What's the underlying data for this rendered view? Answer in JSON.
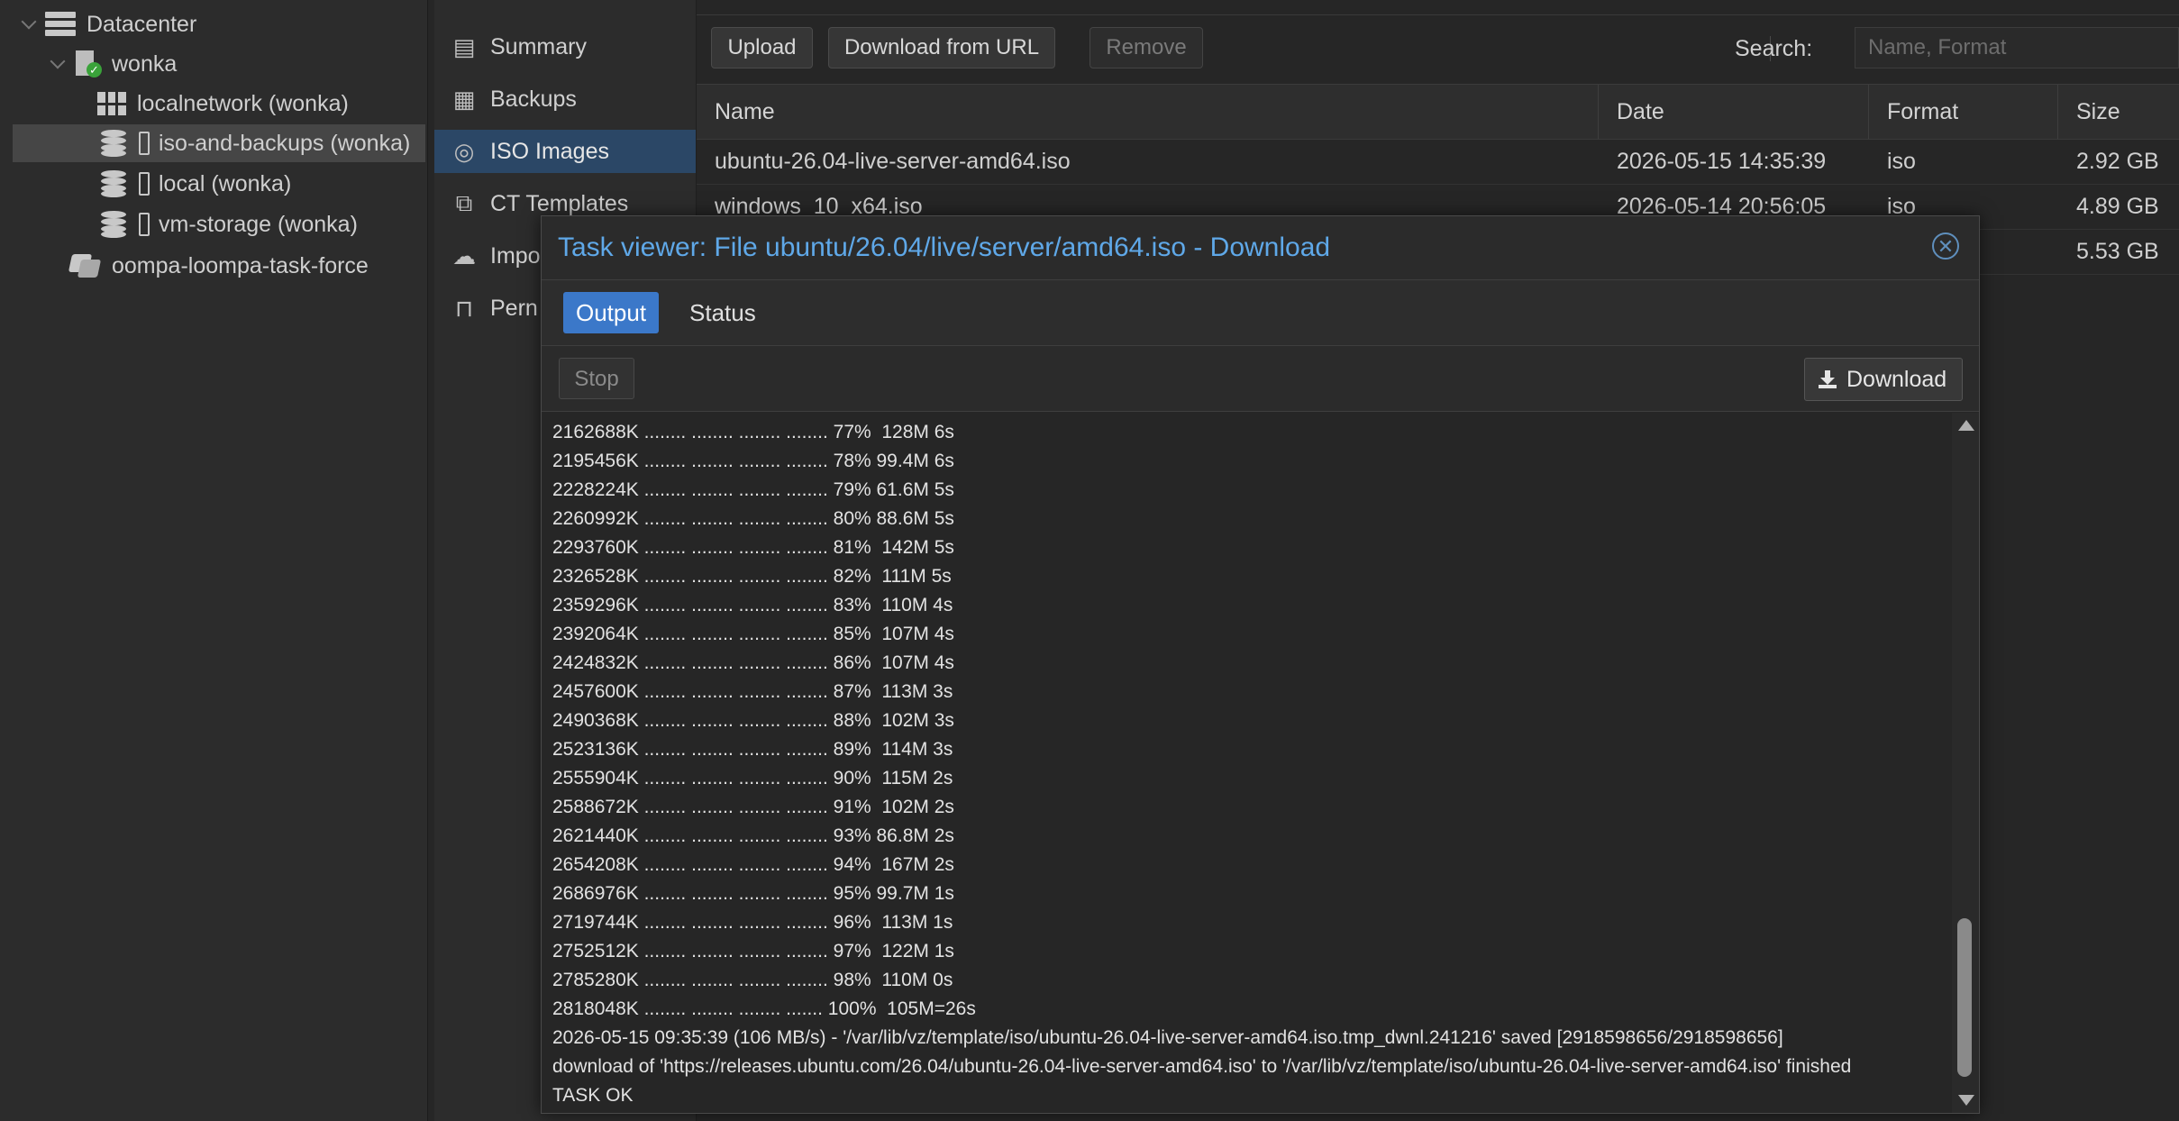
{
  "tree": {
    "datacenter": "Datacenter",
    "node": "wonka",
    "items": [
      {
        "label": "localnetwork (wonka)",
        "icon": "grid-icon"
      },
      {
        "label": "iso-and-backups (wonka)",
        "icon": "storage-icon"
      },
      {
        "label": "local (wonka)",
        "icon": "storage-icon"
      },
      {
        "label": "vm-storage (wonka)",
        "icon": "storage-icon"
      }
    ],
    "pool": "oompa-loompa-task-force",
    "selected": "iso-and-backups (wonka)"
  },
  "nav": {
    "items": [
      "Summary",
      "Backups",
      "ISO Images",
      "CT Templates",
      "Impo",
      "Pern"
    ],
    "selected": "ISO Images"
  },
  "toolbar": {
    "upload": "Upload",
    "download_url": "Download from URL",
    "remove": "Remove",
    "search_label": "Search:",
    "search_placeholder": "Name, Format"
  },
  "grid": {
    "columns": [
      "Name",
      "Date",
      "Format",
      "Size"
    ],
    "rows": [
      {
        "name": "ubuntu-26.04-live-server-amd64.iso",
        "date": "2026-05-15 14:35:39",
        "format": "iso",
        "size": "2.92 GB"
      },
      {
        "name": "windows_10_x64.iso",
        "date": "2026-05-14 20:56:05",
        "format": "iso",
        "size": "4.89 GB"
      },
      {
        "name": "",
        "date": "",
        "format": "",
        "size": "5.53 GB"
      }
    ]
  },
  "modal": {
    "title": "Task viewer: File ubuntu/26.04/live/server/amd64.iso - Download",
    "tabs": [
      "Output",
      "Status"
    ],
    "active_tab": "Output",
    "stop": "Stop",
    "download": "Download",
    "log": [
      "2162688K ........ ........ ........ ........ 77%  128M 6s",
      "2195456K ........ ........ ........ ........ 78% 99.4M 6s",
      "2228224K ........ ........ ........ ........ 79% 61.6M 5s",
      "2260992K ........ ........ ........ ........ 80% 88.6M 5s",
      "2293760K ........ ........ ........ ........ 81%  142M 5s",
      "2326528K ........ ........ ........ ........ 82%  111M 5s",
      "2359296K ........ ........ ........ ........ 83%  110M 4s",
      "2392064K ........ ........ ........ ........ 85%  107M 4s",
      "2424832K ........ ........ ........ ........ 86%  107M 4s",
      "2457600K ........ ........ ........ ........ 87%  113M 3s",
      "2490368K ........ ........ ........ ........ 88%  102M 3s",
      "2523136K ........ ........ ........ ........ 89%  114M 3s",
      "2555904K ........ ........ ........ ........ 90%  115M 2s",
      "2588672K ........ ........ ........ ........ 91%  102M 2s",
      "2621440K ........ ........ ........ ........ 93% 86.8M 2s",
      "2654208K ........ ........ ........ ........ 94%  167M 2s",
      "2686976K ........ ........ ........ ........ 95% 99.7M 1s",
      "2719744K ........ ........ ........ ........ 96%  113M 1s",
      "2752512K ........ ........ ........ ........ 97%  122M 1s",
      "2785280K ........ ........ ........ ........ 98%  110M 0s",
      "2818048K ........ ........ ........ ....... 100%  105M=26s",
      "2026-05-15 09:35:39 (106 MB/s) - '/var/lib/vz/template/iso/ubuntu-26.04-live-server-amd64.iso.tmp_dwnl.241216' saved [2918598656/2918598656]",
      "download of 'https://releases.ubuntu.com/26.04/ubuntu-26.04-live-server-amd64.iso' to '/var/lib/vz/template/iso/ubuntu-26.04-live-server-amd64.iso' finished",
      "TASK OK"
    ]
  },
  "colors": {
    "accent": "#3b78c9",
    "title_blue": "#5fa8e8",
    "selected_nav": "#2b4766",
    "ok_green": "#3aa33a"
  }
}
